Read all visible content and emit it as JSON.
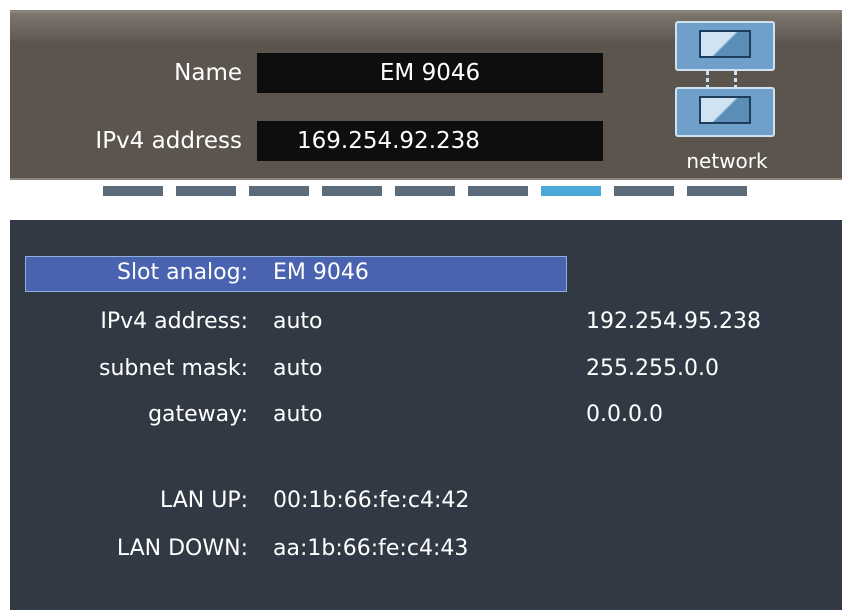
{
  "header": {
    "name_label": "Name",
    "name_value": "EM 9046",
    "ip_label": "IPv4 address",
    "ip_value": "169.254.92.238",
    "network_label": "network"
  },
  "pager": {
    "count": 9,
    "active_index": 6
  },
  "details": {
    "rows": [
      {
        "label": "Slot analog:",
        "value": "EM 9046",
        "value2": "",
        "selected": true
      },
      {
        "label": "IPv4 address:",
        "value": "auto",
        "value2": "192.254.95.238"
      },
      {
        "label": "subnet mask:",
        "value": "auto",
        "value2": "255.255.0.0"
      },
      {
        "label": "gateway:",
        "value": "auto",
        "value2": "0.0.0.0"
      },
      {
        "label": "LAN UP:",
        "value": "00:1b:66:fe:c4:42",
        "value2": ""
      },
      {
        "label": "LAN DOWN:",
        "value": "aa:1b:66:fe:c4:43",
        "value2": ""
      }
    ]
  },
  "colors": {
    "header_bg": "#5c554d",
    "details_bg": "#313a44",
    "selection": "#4a63b1",
    "pager_active": "#4aa9d9",
    "pager_inactive": "#5b6b79",
    "network_icon": "#6fa0c9"
  }
}
